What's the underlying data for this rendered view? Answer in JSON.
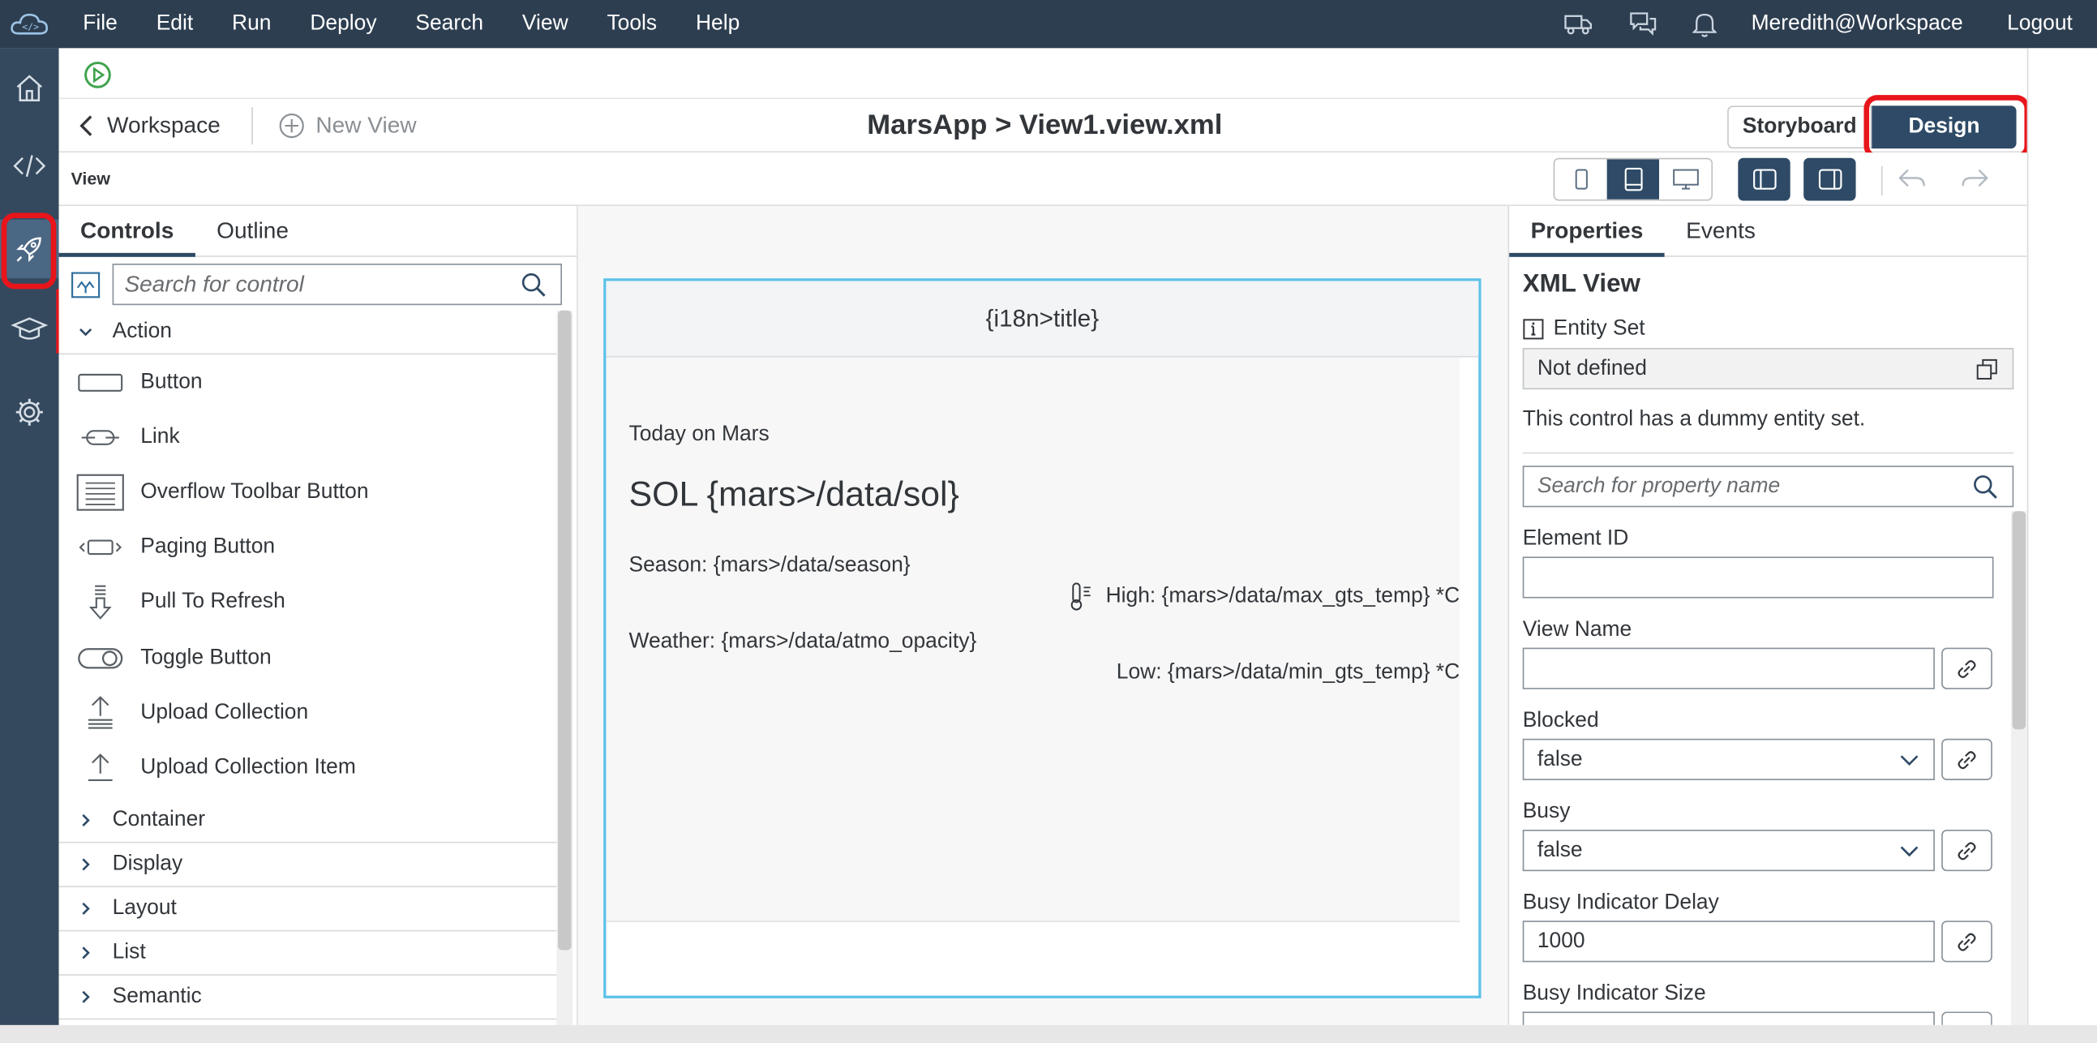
{
  "menubar": {
    "items": [
      "File",
      "Edit",
      "Run",
      "Deploy",
      "Search",
      "View",
      "Tools",
      "Help"
    ],
    "user": "Meredith@Workspace",
    "logout": "Logout"
  },
  "header": {
    "back_label": "Workspace",
    "new_view_label": "New View",
    "title": "MarsApp > View1.view.xml",
    "storyboard_label": "Storyboard",
    "design_label": "Design"
  },
  "subheader": {
    "label": "View"
  },
  "left_panel": {
    "tabs": [
      "Controls",
      "Outline"
    ],
    "search_placeholder": "Search for control",
    "expanded_group": "Action",
    "controls": [
      "Button",
      "Link",
      "Overflow Toolbar Button",
      "Paging Button",
      "Pull To Refresh",
      "Toggle Button",
      "Upload Collection",
      "Upload Collection Item"
    ],
    "collapsed_groups": [
      "Container",
      "Display",
      "Layout",
      "List",
      "Semantic"
    ]
  },
  "canvas": {
    "page_title": "{i18n>title}",
    "subtitle": "Today on Mars",
    "sol": "SOL {mars>/data/sol}",
    "season": "Season: {mars>/data/season}",
    "high": "High: {mars>/data/max_gts_temp} *C",
    "weather": "Weather: {mars>/data/atmo_opacity}",
    "low": "Low: {mars>/data/min_gts_temp} *C"
  },
  "right_panel": {
    "tabs": [
      "Properties",
      "Events"
    ],
    "heading": "XML View",
    "entity_set_label": "Entity Set",
    "entity_set_value": "Not defined",
    "entity_note": "This control has a dummy entity set.",
    "search_placeholder": "Search for property name",
    "element_id_label": "Element ID",
    "element_id_value": "",
    "view_name_label": "View Name",
    "view_name_value": "",
    "blocked_label": "Blocked",
    "blocked_value": "false",
    "busy_label": "Busy",
    "busy_value": "false",
    "busy_delay_label": "Busy Indicator Delay",
    "busy_delay_value": "1000",
    "busy_size_label": "Busy Indicator Size"
  },
  "colors": {
    "menubar": "#2d3e50",
    "accent": "#2e4a66",
    "highlight": "#e8151b",
    "canvas_border": "#5cc2e8"
  }
}
